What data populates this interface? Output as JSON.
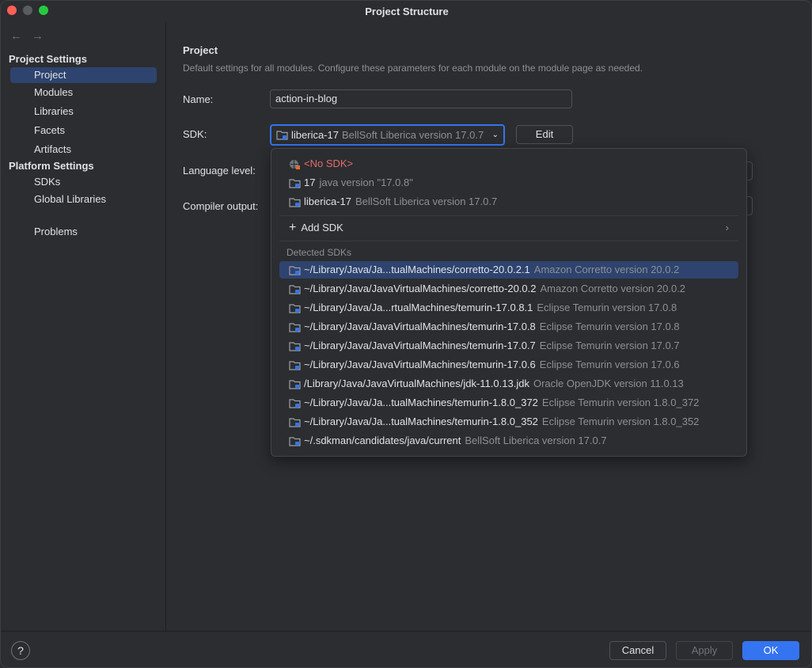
{
  "window": {
    "title": "Project Structure"
  },
  "sidebar": {
    "project_settings_label": "Project Settings",
    "platform_settings_label": "Platform Settings",
    "items": [
      {
        "label": "Project",
        "selected": true
      },
      {
        "label": "Modules"
      },
      {
        "label": "Libraries"
      },
      {
        "label": "Facets"
      },
      {
        "label": "Artifacts"
      },
      {
        "label": "SDKs"
      },
      {
        "label": "Global Libraries"
      },
      {
        "label": "Problems"
      }
    ]
  },
  "main": {
    "title": "Project",
    "description": "Default settings for all modules. Configure these parameters for each module on the module page as needed.",
    "name_label": "Name:",
    "name_value": "action-in-blog",
    "sdk_label": "SDK:",
    "sdk_selected_name": "liberica-17",
    "sdk_selected_desc": "BellSoft Liberica version 17.0.7",
    "edit_label": "Edit",
    "language_level_label": "Language level:",
    "compiler_output_label": "Compiler output:"
  },
  "popup": {
    "no_sdk": "<No SDK>",
    "configured": [
      {
        "name": "17",
        "desc": "java version \"17.0.8\""
      },
      {
        "name": "liberica-17",
        "desc": "BellSoft Liberica version 17.0.7"
      }
    ],
    "add_sdk": "Add SDK",
    "detected_label": "Detected SDKs",
    "detected": [
      {
        "name": "~/Library/Java/Ja...tualMachines/corretto-20.0.2.1",
        "desc": "Amazon Corretto version 20.0.2",
        "selected": true
      },
      {
        "name": "~/Library/Java/JavaVirtualMachines/corretto-20.0.2",
        "desc": "Amazon Corretto version 20.0.2"
      },
      {
        "name": "~/Library/Java/Ja...rtualMachines/temurin-17.0.8.1",
        "desc": "Eclipse Temurin version 17.0.8"
      },
      {
        "name": "~/Library/Java/JavaVirtualMachines/temurin-17.0.8",
        "desc": "Eclipse Temurin version 17.0.8"
      },
      {
        "name": "~/Library/Java/JavaVirtualMachines/temurin-17.0.7",
        "desc": "Eclipse Temurin version 17.0.7"
      },
      {
        "name": "~/Library/Java/JavaVirtualMachines/temurin-17.0.6",
        "desc": "Eclipse Temurin version 17.0.6"
      },
      {
        "name": "/Library/Java/JavaVirtualMachines/jdk-11.0.13.jdk",
        "desc": "Oracle OpenJDK version 11.0.13"
      },
      {
        "name": "~/Library/Java/Ja...tualMachines/temurin-1.8.0_372",
        "desc": "Eclipse Temurin version 1.8.0_372"
      },
      {
        "name": "~/Library/Java/Ja...tualMachines/temurin-1.8.0_352",
        "desc": "Eclipse Temurin version 1.8.0_352"
      },
      {
        "name": "~/.sdkman/candidates/java/current",
        "desc": "BellSoft Liberica version 17.0.7"
      }
    ]
  },
  "footer": {
    "help_label": "?",
    "cancel_label": "Cancel",
    "apply_label": "Apply",
    "ok_label": "OK"
  },
  "colors": {
    "accent": "#3574f0",
    "selection": "#2e436e",
    "background": "#2b2d30",
    "no_sdk_red": "#e06c6c",
    "muted_text": "#8c8f94"
  },
  "icons": {
    "sdk": "folder-sdk-icon",
    "no_sdk": "globe-error-icon",
    "add": "plus-icon",
    "submenu": "chevron-right-icon"
  }
}
